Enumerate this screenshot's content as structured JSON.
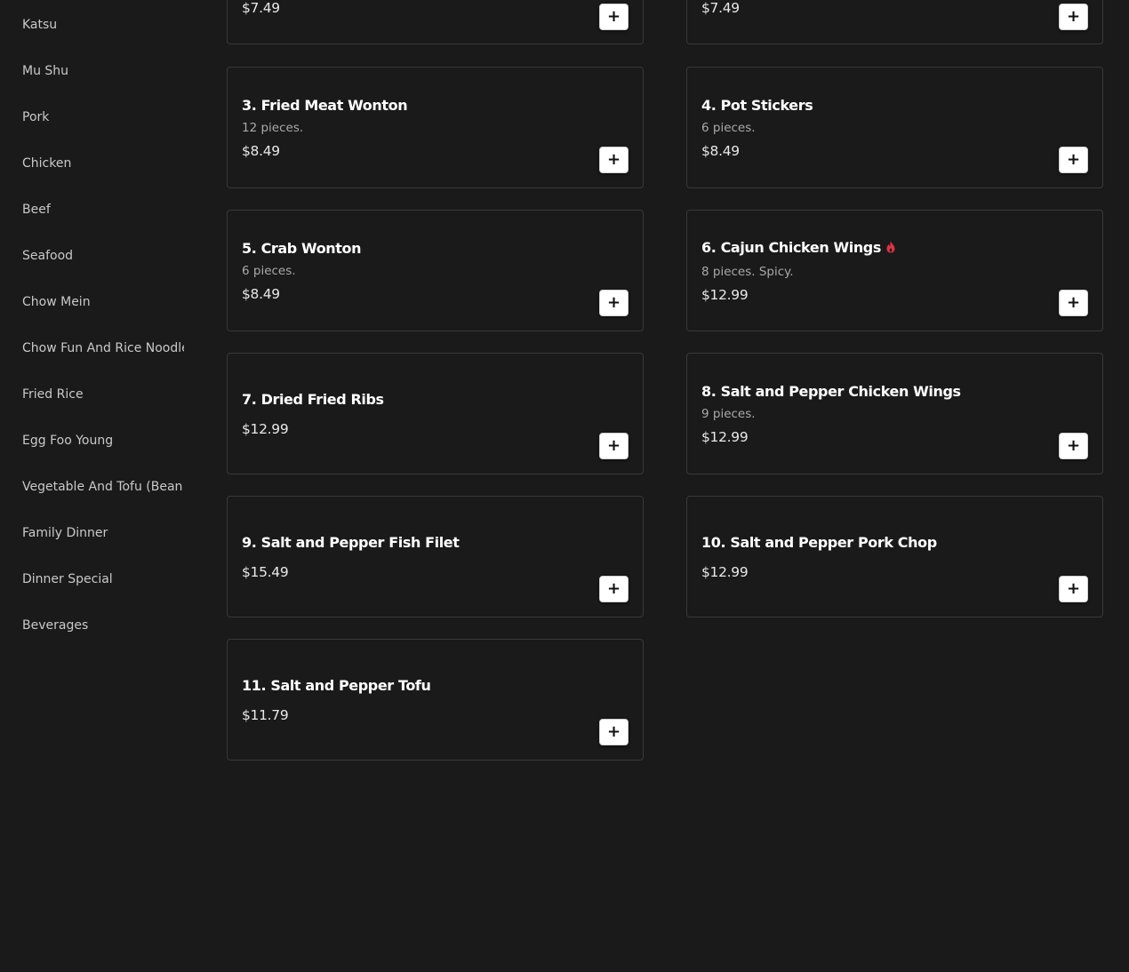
{
  "categories": [
    "Katsu",
    "Mu Shu",
    "Pork",
    "Chicken",
    "Beef",
    "Seafood",
    "Chow Mein",
    "Chow Fun And Rice Noodle",
    "Fried Rice",
    "Egg Foo Young",
    "Vegetable And Tofu (Bean Curd)",
    "Family Dinner",
    "Dinner Special",
    "Beverages"
  ],
  "items": [
    {
      "name": "",
      "description": "",
      "price": "$7.49",
      "add_label": "+"
    },
    {
      "name": "",
      "description": "",
      "price": "$7.49",
      "add_label": "+"
    },
    {
      "name": "3. Fried Meat Wonton",
      "description": "12 pieces.",
      "price": "$8.49",
      "add_label": "+"
    },
    {
      "name": "4. Pot Stickers",
      "description": "6 pieces.",
      "price": "$8.49",
      "add_label": "+"
    },
    {
      "name": "5. Crab Wonton",
      "description": "6 pieces.",
      "price": "$8.49",
      "add_label": "+"
    },
    {
      "name": "6. Cajun Chicken Wings",
      "description": "8 pieces. Spicy.",
      "price": "$12.99",
      "add_label": "+",
      "spicy_icon": "flame-icon",
      "spicy_color": "#e0343f"
    },
    {
      "name": "7. Dried Fried Ribs",
      "description": "",
      "price": "$12.99",
      "add_label": "+"
    },
    {
      "name": "8. Salt and Pepper Chicken Wings",
      "description": "9 pieces.",
      "price": "$12.99",
      "add_label": "+"
    },
    {
      "name": "9. Salt and Pepper Fish Filet",
      "description": "",
      "price": "$15.49",
      "add_label": "+"
    },
    {
      "name": "10. Salt and Pepper Pork Chop",
      "description": "",
      "price": "$12.99",
      "add_label": "+"
    },
    {
      "name": "11. Salt and Pepper Tofu",
      "description": "",
      "price": "$11.79",
      "add_label": "+"
    }
  ],
  "colors": {
    "background": "#1b1a1b",
    "card_border": "#3a393a",
    "button_bg": "#ffffff",
    "spicy": "#e0343f"
  }
}
